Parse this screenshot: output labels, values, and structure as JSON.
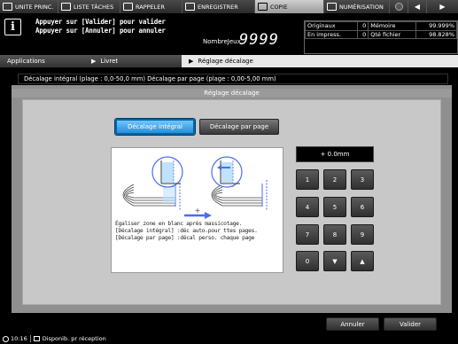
{
  "tabs": [
    {
      "label": "UNITE PRINC.",
      "icon": "home-icon",
      "active": false
    },
    {
      "label": "LISTE TÂCHES",
      "icon": "job-list-icon",
      "active": false
    },
    {
      "label": "RAPPELER",
      "icon": "recall-icon",
      "active": false
    },
    {
      "label": "ENREGISTRER",
      "icon": "register-icon",
      "active": false
    },
    {
      "label": "COPIE",
      "icon": "copy-icon",
      "active": true
    },
    {
      "label": "NUMÉRISATION",
      "icon": "scan-icon",
      "active": false
    }
  ],
  "header": {
    "message_line1": "Appuyer sur [Valider] pour valider",
    "message_line2": "Appuyer sur [Annuler] pour annuler",
    "nb_jobs_label": "NombreJeux",
    "nb_jobs_value": "9999"
  },
  "stats": {
    "originals_label": "Originaux",
    "originals_value": "0",
    "printing_label": "En impress.",
    "printing_value": "0",
    "memory_label": "Mémoire",
    "memory_value": "99.999%",
    "file_qty_label": "Qté fichier",
    "file_qty_value": "98.828%"
  },
  "breadcrumb": [
    "Applications",
    "Livret",
    "Réglage décalage"
  ],
  "range_text": "Décalage intégral (plage : 0,0-50,0 mm) Décalage par page (plage : 0,00-5,00 mm)",
  "panel_title": "Réglage décalage",
  "options": {
    "integral": "Décalage intégral",
    "per_page": "Décalage par page",
    "selected": "integral"
  },
  "illustration": {
    "plus_sign": "+",
    "text_line1": "Égaliser zone en blanc après massicotage.",
    "text_line2": "[Décalage intégral] :déc auto.pour ttes pages.",
    "text_line3": "[Décalage par page] :décal perso. chaque page"
  },
  "display_value": "+  0.0mm",
  "keypad": [
    "1",
    "2",
    "3",
    "4",
    "5",
    "6",
    "7",
    "8",
    "9",
    "0",
    "▼",
    "▲"
  ],
  "footer": {
    "cancel_label": "Annuler",
    "validate_label": "Valider"
  },
  "status": {
    "time": "10:16",
    "text": "Disponib. pr réception"
  },
  "colors": {
    "accent_selected": "#2a8ed6",
    "arrow_blue": "#4a6ef0"
  }
}
